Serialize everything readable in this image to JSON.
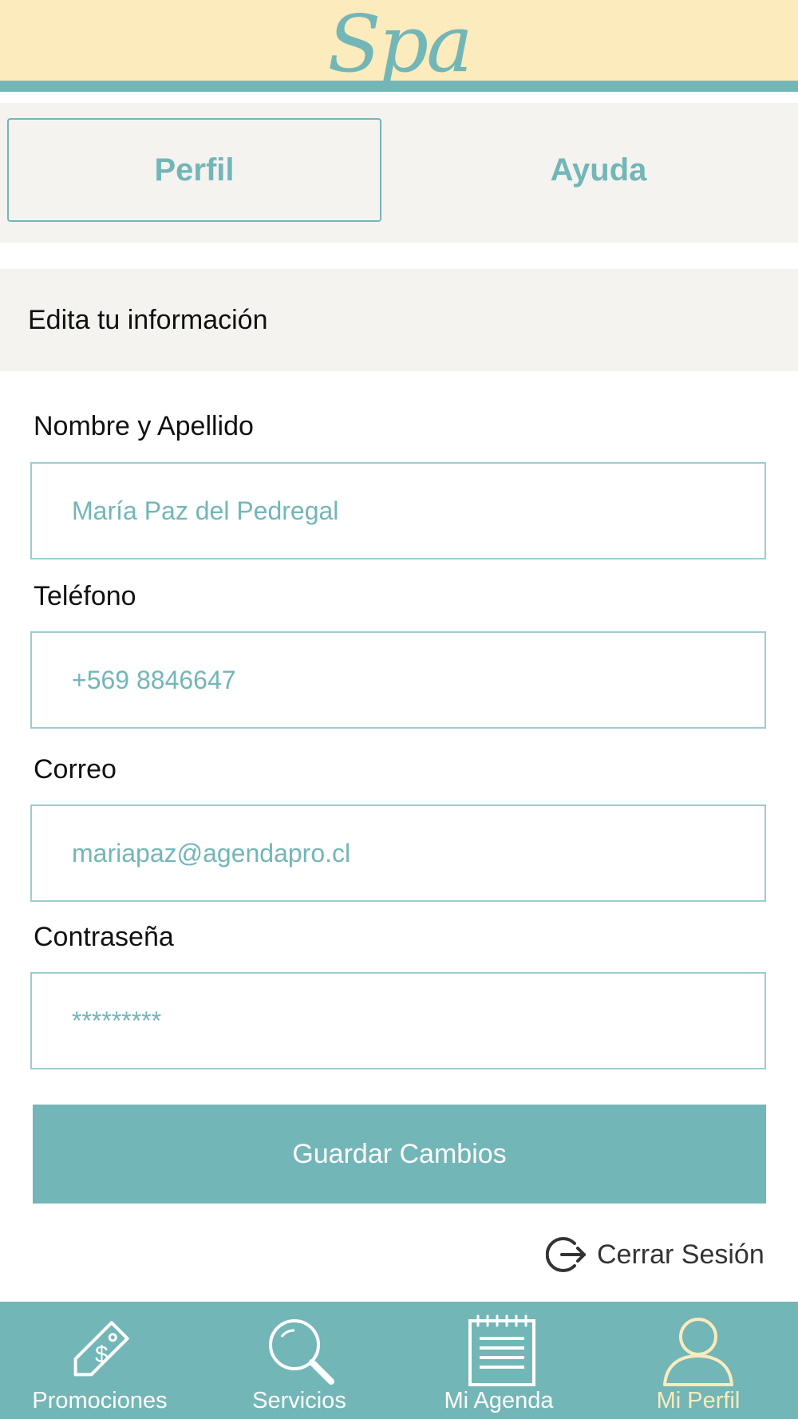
{
  "app": {
    "logo": "Spa"
  },
  "tabs": [
    {
      "label": "Perfil",
      "active": true
    },
    {
      "label": "Ayuda",
      "active": false
    }
  ],
  "section": {
    "title": "Edita tu información"
  },
  "form": {
    "name": {
      "label": "Nombre y Apellido",
      "value": "María Paz del Pedregal"
    },
    "phone": {
      "label": "Teléfono",
      "value": "+569 8846647"
    },
    "email": {
      "label": "Correo",
      "value": "mariapaz@agendapro.cl"
    },
    "password": {
      "label": "Contraseña",
      "value": "*********"
    }
  },
  "actions": {
    "save_label": "Guardar Cambios",
    "logout_label": "Cerrar Sesión",
    "logout_icon": "logout-icon"
  },
  "bottom_nav": [
    {
      "label": "Promociones",
      "icon": "price-tag-icon",
      "active": false
    },
    {
      "label": "Servicios",
      "icon": "search-icon",
      "active": false
    },
    {
      "label": "Mi Agenda",
      "icon": "notepad-icon",
      "active": false
    },
    {
      "label": "Mi Perfil",
      "icon": "user-icon",
      "active": true
    }
  ],
  "colors": {
    "primary": "#73b6b7",
    "header_bg": "#fcebbd",
    "panel_bg": "#f4f3f0",
    "active_nav": "#fcebbd"
  }
}
